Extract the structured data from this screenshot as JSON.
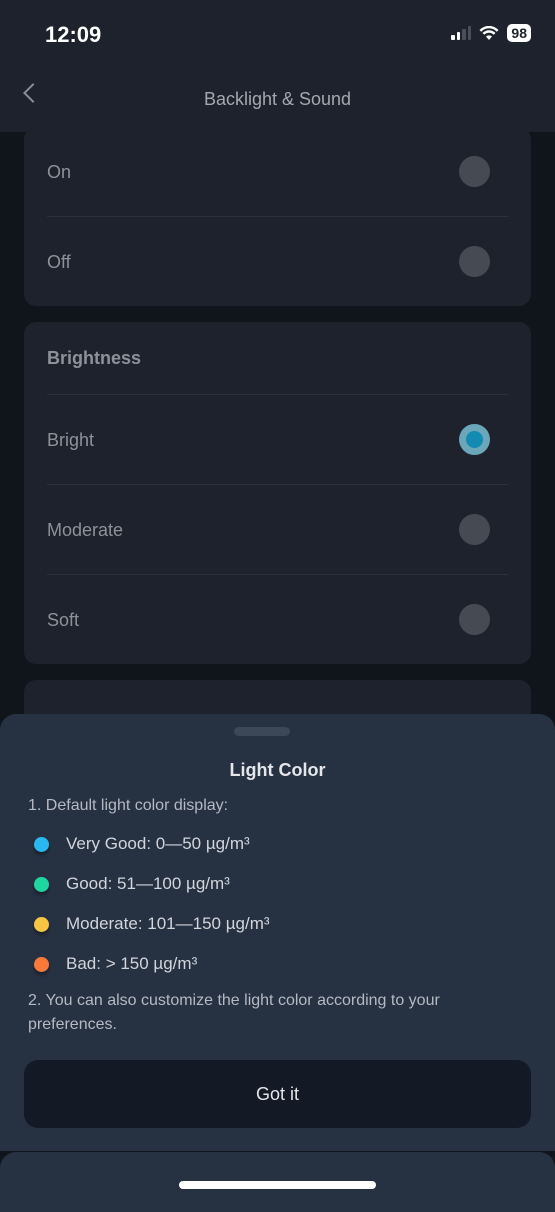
{
  "status_bar": {
    "time": "12:09",
    "battery": "98"
  },
  "header": {
    "title": "Backlight & Sound"
  },
  "backlight": {
    "options": [
      {
        "label": "On",
        "selected": false
      },
      {
        "label": "Off",
        "selected": false
      }
    ]
  },
  "brightness": {
    "title": "Brightness",
    "options": [
      {
        "label": "Bright",
        "selected": true
      },
      {
        "label": "Moderate",
        "selected": false
      },
      {
        "label": "Soft",
        "selected": false
      }
    ]
  },
  "light_color_card": {
    "title": "Light Color"
  },
  "sheet": {
    "title": "Light Color",
    "intro": "1. Default light color display:",
    "levels": [
      {
        "label": "Very Good: 0—50 µg/m³",
        "color": "#2ab8f0"
      },
      {
        "label": "Good: 51—100 µg/m³",
        "color": "#1fd5a0"
      },
      {
        "label": "Moderate: 101—150 µg/m³",
        "color": "#f6c544"
      },
      {
        "label": "Bad: > 150 µg/m³",
        "color": "#f77a3a"
      }
    ],
    "note": "2. You can also customize the light color according to your preferences.",
    "button": "Got it"
  },
  "colors": {
    "accent": "#138ab0"
  }
}
